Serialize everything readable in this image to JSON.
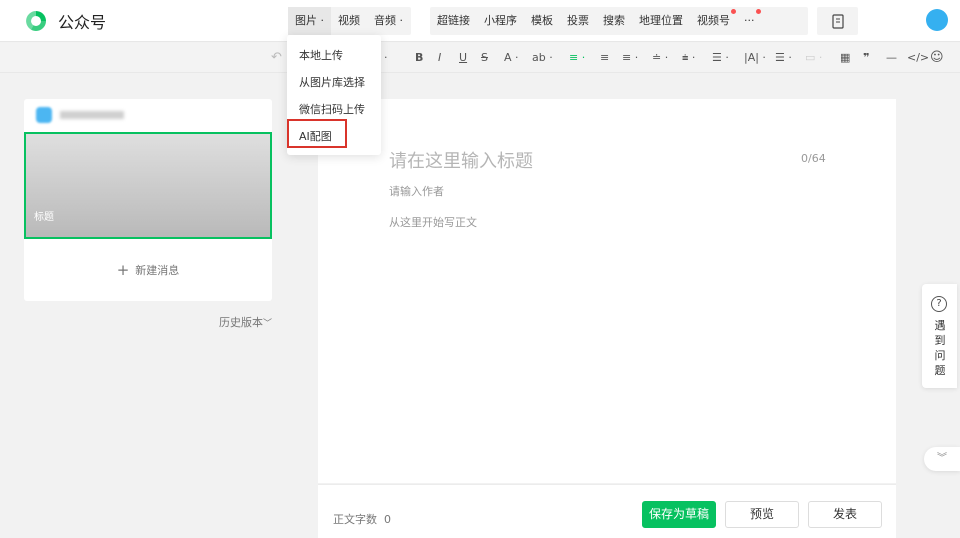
{
  "brand": {
    "name": "公众号",
    "accent": "#07c160"
  },
  "menu": {
    "group1": [
      {
        "label": "图片",
        "caret": "·"
      },
      {
        "label": "视频"
      },
      {
        "label": "音频",
        "caret": "·"
      }
    ],
    "group2": [
      {
        "label": "超链接"
      },
      {
        "label": "小程序"
      },
      {
        "label": "模板"
      },
      {
        "label": "投票"
      },
      {
        "label": "搜索"
      },
      {
        "label": "地理位置"
      },
      {
        "label": "视频号",
        "dot": true
      },
      {
        "label": "···",
        "dot": true
      }
    ]
  },
  "toolbar": {
    "undo": "↶",
    "px": "px ·",
    "bold": "B",
    "italic": "I",
    "underline": "U",
    "strike": "S",
    "font_color": "A ·",
    "bg_color": "ab ·",
    "align_left": "≡ ·",
    "quote": "❞",
    "divider": "—",
    "code": "</>",
    "emoji": "☺"
  },
  "dropdown": {
    "items": [
      "本地上传",
      "从图片库选择",
      "微信扫码上传",
      "AI配图"
    ],
    "highlighted": "AI配图",
    "highlight_color": "#d9342b"
  },
  "article": {
    "account_name": "",
    "cover_title": "标题",
    "new_message": "新建消息",
    "new_message_icon": "+",
    "history": "历史版本",
    "history_caret": "﹀"
  },
  "editor": {
    "title_placeholder": "请在这里输入标题",
    "title_count": "0/64",
    "author_placeholder": "请输入作者",
    "body_placeholder": "从这里开始写正文"
  },
  "footer": {
    "word_count_label": "正文字数",
    "word_count": "0",
    "save_draft": "保存为草稿",
    "preview": "预览",
    "publish": "发表"
  },
  "help": {
    "icon": "?",
    "label": [
      "遇",
      "到",
      "问",
      "题"
    ],
    "collapse": "︾"
  }
}
